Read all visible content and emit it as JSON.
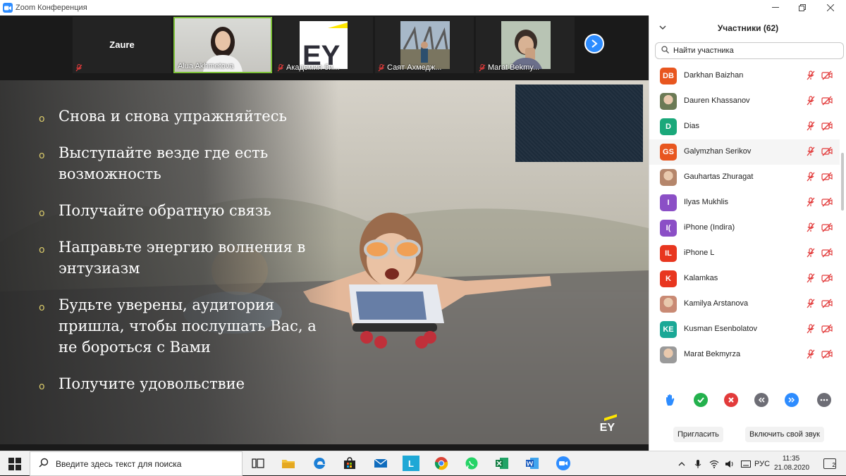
{
  "window": {
    "title": "Zoom Конференция"
  },
  "video_strip": {
    "tiles": [
      {
        "name": "Zaure",
        "muted": true,
        "type": "name-only"
      },
      {
        "name": "Alua Akhmetova",
        "muted": false,
        "type": "video",
        "active": true
      },
      {
        "name": "Академия би...",
        "muted": true,
        "type": "video",
        "logo_text": "EY"
      },
      {
        "name": "Саят Ахмедж...",
        "muted": true,
        "type": "video"
      },
      {
        "name": "Marat Bekmy...",
        "muted": true,
        "type": "video"
      }
    ],
    "next_icon": "chevron-right-icon"
  },
  "slide": {
    "bullets": [
      "Снова и снова упражняйтесь",
      "Выступайте везде где есть возможность",
      "Получайте обратную связь",
      "Направьте энергию волнения в энтузиазм",
      "Будьте уверены, аудитория пришла, чтобы послушать Вас, а не бороться с Вами",
      "Получите удовольствие"
    ],
    "logo_text": "EY",
    "accent": "#d8c96a"
  },
  "participants": {
    "title": "Участники (62)",
    "search_placeholder": "Найти участника",
    "list": [
      {
        "initials": "DB",
        "name": "Darkhan Baizhan",
        "color": "#e8561f",
        "photo": false
      },
      {
        "initials": "",
        "name": "Dauren Khassanov",
        "color": "#6b7a55",
        "photo": true
      },
      {
        "initials": "D",
        "name": "Dias",
        "color": "#1aa87a",
        "photo": false
      },
      {
        "initials": "GS",
        "name": "Galymzhan Serikov",
        "color": "#e8561f",
        "photo": false,
        "highlight": true
      },
      {
        "initials": "",
        "name": "Gauhartas Zhuragat",
        "color": "#b5866b",
        "photo": true
      },
      {
        "initials": "I",
        "name": "Ilyas Mukhlis",
        "color": "#8b4fc6",
        "photo": false
      },
      {
        "initials": "I(",
        "name": "iPhone (Indira)",
        "color": "#8b4fc6",
        "photo": false
      },
      {
        "initials": "IL",
        "name": "iPhone L",
        "color": "#e8361f",
        "photo": false
      },
      {
        "initials": "K",
        "name": "Kalamkas",
        "color": "#e8361f",
        "photo": false
      },
      {
        "initials": "",
        "name": "Kamilya Arstanova",
        "color": "#c98a74",
        "photo": true
      },
      {
        "initials": "KE",
        "name": "Kusman Esenbolatov",
        "color": "#1aa896",
        "photo": false
      },
      {
        "initials": "",
        "name": "Marat Bekmyrza",
        "color": "#9a9a9a",
        "photo": true
      }
    ],
    "status_colors": {
      "muted": "#e23b3b"
    },
    "reactions": [
      {
        "icon": "raise-hand-icon",
        "color": "#2d8cff"
      },
      {
        "icon": "yes-check-icon",
        "color": "#23b14d"
      },
      {
        "icon": "no-x-icon",
        "color": "#e23b3b"
      },
      {
        "icon": "go-slower-icon",
        "color": "#6d6d75"
      },
      {
        "icon": "go-faster-icon",
        "color": "#2d8cff"
      },
      {
        "icon": "more-icon",
        "color": "#6d6d75"
      }
    ],
    "invite_label": "Пригласить",
    "unmute_label": "Включить свой звук"
  },
  "taskbar": {
    "search_text": "Введите здесь текст для поиска",
    "language": "РУС",
    "time": "11:35",
    "date": "21.08.2020",
    "notifications": "2",
    "apps": [
      "task-view-icon",
      "file-explorer-icon",
      "edge-icon",
      "store-icon",
      "mail-icon",
      "lingvo-icon",
      "chrome-icon",
      "whatsapp-icon",
      "excel-icon",
      "word-icon",
      "zoom-icon"
    ]
  }
}
